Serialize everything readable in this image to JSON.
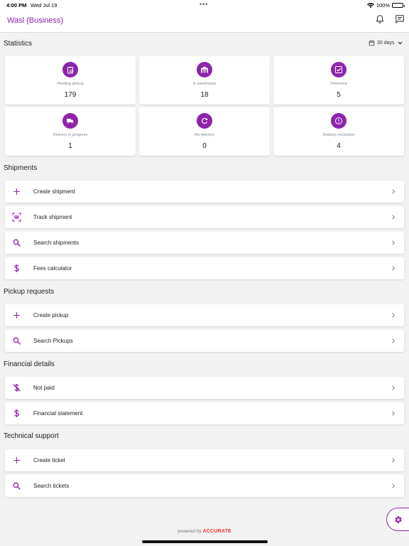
{
  "status_bar": {
    "time": "4:00 PM",
    "date": "Wed Jul 19",
    "dots": "•••",
    "battery": "100%"
  },
  "app_bar": {
    "title": "Wasl (Business)",
    "icons": [
      "bell-icon",
      "chat-icon"
    ]
  },
  "statistics": {
    "title": "Statistics",
    "period": "30 days",
    "cards": [
      {
        "label": "Pending pickup",
        "value": "179",
        "icon": "clipboard-clock-icon"
      },
      {
        "label": "In warehouse",
        "value": "18",
        "icon": "warehouse-icon"
      },
      {
        "label": "Delivered",
        "value": "5",
        "icon": "checkbox-icon"
      },
      {
        "label": "Delivery in progress",
        "value": "1",
        "icon": "truck-icon"
      },
      {
        "label": "Re-delivery",
        "value": "0",
        "icon": "refresh-icon"
      },
      {
        "label": "Delivery exception",
        "value": "4",
        "icon": "alert-icon"
      }
    ]
  },
  "shipments": {
    "title": "Shipments",
    "items": [
      {
        "label": "Create shipment",
        "icon": "plus-icon"
      },
      {
        "label": "Track shipment",
        "icon": "barcode-scan-icon"
      },
      {
        "label": "Search shipments",
        "icon": "search-icon"
      },
      {
        "label": "Fees calculator",
        "icon": "dollar-icon"
      }
    ]
  },
  "pickup_requests": {
    "title": "Pickup requests",
    "items": [
      {
        "label": "Create pickup",
        "icon": "plus-icon"
      },
      {
        "label": "Search Pickups",
        "icon": "search-icon"
      }
    ]
  },
  "financial_details": {
    "title": "Financial details",
    "items": [
      {
        "label": "Not paid",
        "icon": "dollar-off-icon"
      },
      {
        "label": "Financial statement",
        "icon": "dollar-icon"
      }
    ]
  },
  "technical_support": {
    "title": "Technical support",
    "items": [
      {
        "label": "Create ticket",
        "icon": "plus-icon"
      },
      {
        "label": "Search tickets",
        "icon": "search-icon"
      }
    ]
  },
  "footer": {
    "powered_by": "powered by",
    "brand": "ACCURATE"
  },
  "colors": {
    "accent": "#8e24aa",
    "background": "#f2f2f2",
    "brand": "#e53935"
  }
}
